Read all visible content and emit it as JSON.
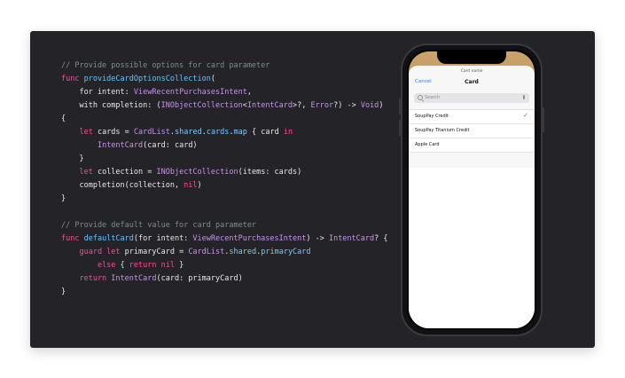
{
  "code_lines": [
    [
      {
        "t": "// Provide possible options for card parameter",
        "c": "c-com"
      }
    ],
    [
      {
        "t": "func ",
        "c": "c-kw"
      },
      {
        "t": "provideCardOptionsCollection",
        "c": "c-fn"
      },
      {
        "t": "(",
        "c": ""
      }
    ],
    [
      {
        "t": "    for intent: ",
        "c": ""
      },
      {
        "t": "ViewRecentPurchasesIntent",
        "c": "c-type"
      },
      {
        "t": ",",
        "c": ""
      }
    ],
    [
      {
        "t": "    with completion: (",
        "c": ""
      },
      {
        "t": "INObjectCollection",
        "c": "c-type"
      },
      {
        "t": "<",
        "c": ""
      },
      {
        "t": "IntentCard",
        "c": "c-type"
      },
      {
        "t": ">?, ",
        "c": ""
      },
      {
        "t": "Error",
        "c": "c-type"
      },
      {
        "t": "?) -> ",
        "c": ""
      },
      {
        "t": "Void",
        "c": "c-type"
      },
      {
        "t": ")",
        "c": ""
      }
    ],
    [
      {
        "t": "{",
        "c": ""
      }
    ],
    [
      {
        "t": "    let ",
        "c": "c-kw"
      },
      {
        "t": "cards = ",
        "c": ""
      },
      {
        "t": "CardList",
        "c": "c-type"
      },
      {
        "t": ".",
        "c": ""
      },
      {
        "t": "shared",
        "c": "c-prop"
      },
      {
        "t": ".",
        "c": ""
      },
      {
        "t": "cards",
        "c": "c-prop"
      },
      {
        "t": ".",
        "c": ""
      },
      {
        "t": "map",
        "c": "c-prop"
      },
      {
        "t": " { card ",
        "c": ""
      },
      {
        "t": "in",
        "c": "c-kw"
      }
    ],
    [
      {
        "t": "        ",
        "c": ""
      },
      {
        "t": "IntentCard",
        "c": "c-type"
      },
      {
        "t": "(card: card)",
        "c": ""
      }
    ],
    [
      {
        "t": "    }",
        "c": ""
      }
    ],
    [
      {
        "t": "    let ",
        "c": "c-kw"
      },
      {
        "t": "collection = ",
        "c": ""
      },
      {
        "t": "INObjectCollection",
        "c": "c-type"
      },
      {
        "t": "(items: cards)",
        "c": ""
      }
    ],
    [
      {
        "t": "    completion(collection, ",
        "c": ""
      },
      {
        "t": "nil",
        "c": "c-kw"
      },
      {
        "t": ")",
        "c": ""
      }
    ],
    [
      {
        "t": "}",
        "c": ""
      }
    ],
    [
      {
        "t": "",
        "c": ""
      }
    ],
    [
      {
        "t": "// Provide default value for card parameter",
        "c": "c-com"
      }
    ],
    [
      {
        "t": "func ",
        "c": "c-kw"
      },
      {
        "t": "defaultCard",
        "c": "c-fn"
      },
      {
        "t": "(for intent: ",
        "c": ""
      },
      {
        "t": "ViewRecentPurchasesIntent",
        "c": "c-type"
      },
      {
        "t": ") -> ",
        "c": ""
      },
      {
        "t": "IntentCard",
        "c": "c-type"
      },
      {
        "t": "? {",
        "c": ""
      }
    ],
    [
      {
        "t": "    guard let ",
        "c": "c-kw"
      },
      {
        "t": "primaryCard = ",
        "c": ""
      },
      {
        "t": "CardList",
        "c": "c-type"
      },
      {
        "t": ".",
        "c": ""
      },
      {
        "t": "shared",
        "c": "c-prop"
      },
      {
        "t": ".",
        "c": ""
      },
      {
        "t": "primaryCard",
        "c": "c-prop"
      }
    ],
    [
      {
        "t": "        else ",
        "c": "c-kw"
      },
      {
        "t": "{ ",
        "c": ""
      },
      {
        "t": "return nil",
        "c": "c-kw"
      },
      {
        "t": " }",
        "c": ""
      }
    ],
    [
      {
        "t": "    return ",
        "c": "c-kw"
      },
      {
        "t": "IntentCard",
        "c": "c-type"
      },
      {
        "t": "(card: primaryCard)",
        "c": ""
      }
    ],
    [
      {
        "t": "}",
        "c": ""
      }
    ]
  ],
  "phone": {
    "sheet_title": "Card name",
    "cancel_label": "Cancel",
    "nav_title": "Card",
    "search_placeholder": "Search",
    "items": [
      {
        "label": "SoupPay Credit",
        "selected": true
      },
      {
        "label": "SoupPay Titanium Credit",
        "selected": false
      },
      {
        "label": "Apple Card",
        "selected": false
      }
    ],
    "check_glyph": "✓"
  },
  "colors": {
    "slide_bg": "#242428",
    "keyword": "#f2509a",
    "type": "#c792ea",
    "comment": "#7f8c8d",
    "accent": "#2f7cf6"
  }
}
